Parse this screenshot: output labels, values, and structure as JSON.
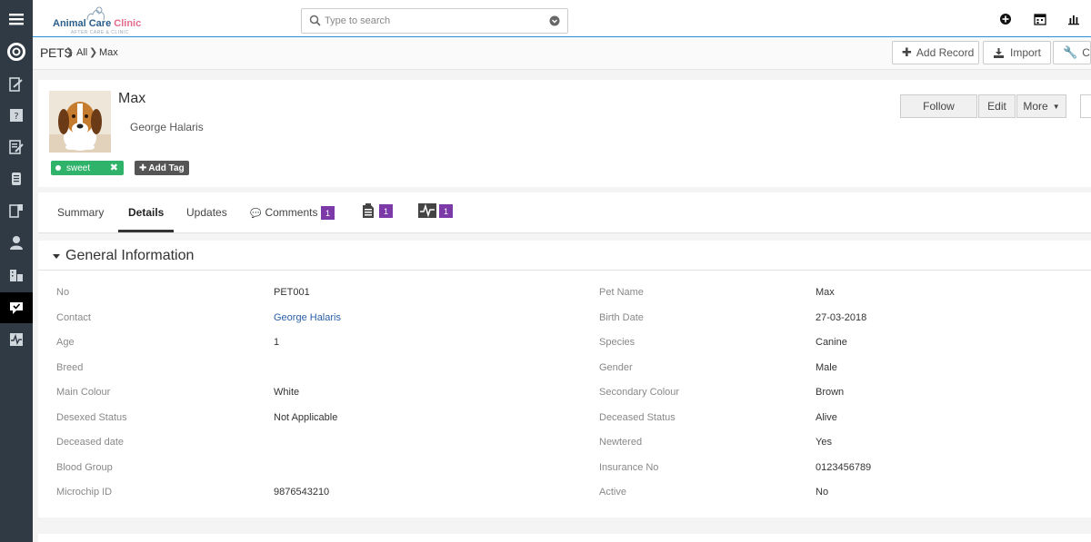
{
  "app": {
    "logo_main": "Animal Care",
    "logo_accent": "Clinic",
    "logo_sub": "AFTER CARE & CLINIC"
  },
  "search": {
    "placeholder": "Type to search"
  },
  "breadcrumb": {
    "module": "PETS",
    "items": [
      "All",
      "Max"
    ]
  },
  "header_actions": {
    "add_record": "Add Record",
    "import": "Import",
    "customize": "Cus"
  },
  "record": {
    "name": "Max",
    "owner": "George Halaris",
    "tag": "sweet",
    "add_tag": "Add Tag",
    "follow": "Follow",
    "edit": "Edit",
    "more": "More"
  },
  "tabs": {
    "summary": "Summary",
    "details": "Details",
    "updates": "Updates",
    "comments": "Comments",
    "comments_count": "1",
    "docs_count": "1",
    "activity_count": "1"
  },
  "section": {
    "title": "General Information",
    "left": [
      {
        "label": "No",
        "value": "PET001"
      },
      {
        "label": "Contact",
        "value": "George Halaris"
      },
      {
        "label": "Age",
        "value": "1"
      },
      {
        "label": "Breed",
        "value": ""
      },
      {
        "label": "Main Colour",
        "value": "White"
      },
      {
        "label": "Desexed Status",
        "value": "Not Applicable"
      },
      {
        "label": "Deceased date",
        "value": ""
      },
      {
        "label": "Blood Group",
        "value": ""
      },
      {
        "label": "Microchip ID",
        "value": "9876543210"
      }
    ],
    "right": [
      {
        "label": "Pet Name",
        "value": "Max"
      },
      {
        "label": "Birth Date",
        "value": "27-03-2018"
      },
      {
        "label": "Species",
        "value": "Canine"
      },
      {
        "label": "Gender",
        "value": "Male"
      },
      {
        "label": "Secondary Colour",
        "value": "Brown"
      },
      {
        "label": "Deceased Status",
        "value": "Alive"
      },
      {
        "label": "Newtered",
        "value": "Yes"
      },
      {
        "label": "Insurance No",
        "value": "0123456789"
      },
      {
        "label": "Active",
        "value": "No"
      }
    ]
  },
  "colors": {
    "sidebar": "#2f3a45",
    "accent": "#2b8fd6",
    "tag": "#2fb36b",
    "badge": "#7b3aa8",
    "link": "#2a5fa8"
  }
}
